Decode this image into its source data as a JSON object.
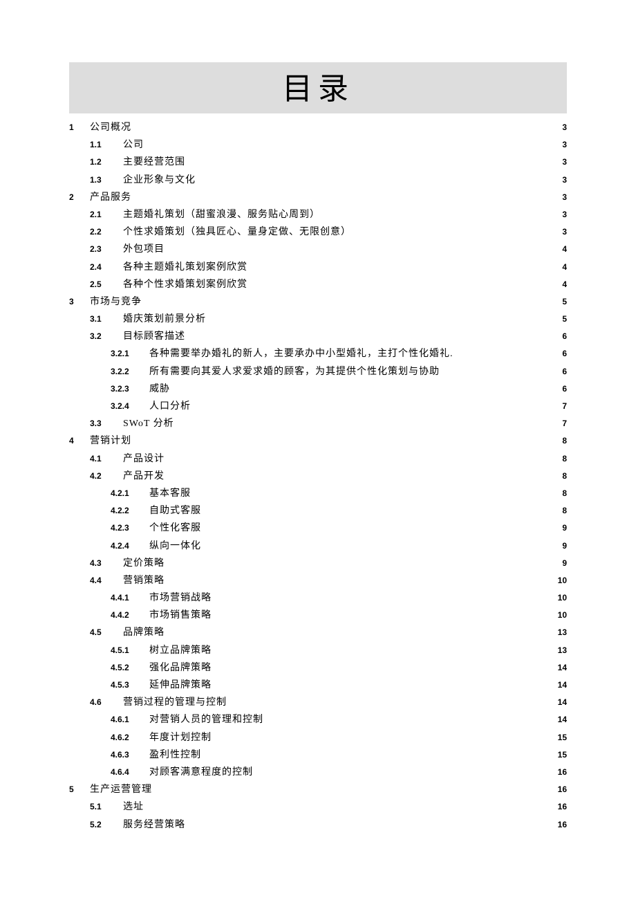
{
  "title": "目录",
  "toc": [
    {
      "level": 1,
      "num": "1",
      "label": "公司概况",
      "page": "3"
    },
    {
      "level": 2,
      "num": "1.1",
      "label": "公司",
      "page": "3"
    },
    {
      "level": 2,
      "num": "1.2",
      "label": "主要经营范围",
      "page": "3"
    },
    {
      "level": 2,
      "num": "1.3",
      "label": "企业形象与文化",
      "page": "3"
    },
    {
      "level": 1,
      "num": "2",
      "label": "产品服务",
      "page": "3"
    },
    {
      "level": 2,
      "num": "2.1",
      "label": "主题婚礼策划（甜蜜浪漫、服务贴心周到）",
      "page": "3"
    },
    {
      "level": 2,
      "num": "2.2",
      "label": "个性求婚策划（独具匠心、量身定做、无限创意）",
      "page": "3"
    },
    {
      "level": 2,
      "num": "2.3",
      "label": "外包项目",
      "page": "4"
    },
    {
      "level": 2,
      "num": "2.4",
      "label": "各种主题婚礼策划案例欣赏",
      "page": "4"
    },
    {
      "level": 2,
      "num": "2.5",
      "label": "各种个性求婚策划案例欣赏",
      "page": "4"
    },
    {
      "level": 1,
      "num": "3",
      "label": "市场与竞争",
      "page": "5"
    },
    {
      "level": 2,
      "num": "3.1",
      "label": "婚庆策划前景分析",
      "page": "5"
    },
    {
      "level": 2,
      "num": "3.2",
      "label": "目标顾客描述",
      "page": "6"
    },
    {
      "level": 3,
      "num": "3.2.1",
      "label": "各种需要举办婚礼的新人，主要承办中小型婚礼，主打个性化婚礼.",
      "page": "6",
      "sep": "short"
    },
    {
      "level": 3,
      "num": "3.2.2",
      "label": "所有需要向其爱人求爱求婚的顾客，为其提供个性化策划与协助",
      "page": "6"
    },
    {
      "level": 3,
      "num": "3.2.3",
      "label": "威胁",
      "page": "6"
    },
    {
      "level": 3,
      "num": "3.2.4",
      "label": "人口分析",
      "page": "7"
    },
    {
      "level": 2,
      "num": "3.3",
      "label": "SWoT 分析",
      "page": "7"
    },
    {
      "level": 1,
      "num": "4",
      "label": "营销计划",
      "page": "8"
    },
    {
      "level": 2,
      "num": "4.1",
      "label": "产品设计",
      "page": "8"
    },
    {
      "level": 2,
      "num": "4.2",
      "label": "产品开发",
      "page": "8"
    },
    {
      "level": 3,
      "num": "4.2.1",
      "label": "基本客服",
      "page": "8"
    },
    {
      "level": 3,
      "num": "4.2.2",
      "label": "自助式客服",
      "page": "8"
    },
    {
      "level": 3,
      "num": "4.2.3",
      "label": "个性化客服",
      "page": "9"
    },
    {
      "level": 3,
      "num": "4.2.4",
      "label": "纵向一体化",
      "page": "9"
    },
    {
      "level": 2,
      "num": "4.3",
      "label": "定价策略",
      "page": "9"
    },
    {
      "level": 2,
      "num": "4.4",
      "label": "营销策略",
      "page": "10"
    },
    {
      "level": 3,
      "num": "4.4.1",
      "label": "市场营销战略",
      "page": "10"
    },
    {
      "level": 3,
      "num": "4.4.2",
      "label": "市场销售策略",
      "page": "10"
    },
    {
      "level": 2,
      "num": "4.5",
      "label": "品牌策略",
      "page": "13"
    },
    {
      "level": 3,
      "num": "4.5.1",
      "label": "树立品牌策略",
      "page": "13"
    },
    {
      "level": 3,
      "num": "4.5.2",
      "label": "强化品牌策略",
      "page": "14"
    },
    {
      "level": 3,
      "num": "4.5.3",
      "label": "延伸品牌策略",
      "page": "14"
    },
    {
      "level": 2,
      "num": "4.6",
      "label": "营销过程的管理与控制",
      "page": "14"
    },
    {
      "level": 3,
      "num": "4.6.1",
      "label": "对营销人员的管理和控制",
      "page": "14"
    },
    {
      "level": 3,
      "num": "4.6.2",
      "label": "年度计划控制",
      "page": "15"
    },
    {
      "level": 3,
      "num": "4.6.3",
      "label": "盈利性控制",
      "page": "15"
    },
    {
      "level": 3,
      "num": "4.6.4",
      "label": "对顾客满意程度的控制",
      "page": "16"
    },
    {
      "level": 1,
      "num": "5",
      "label": "生产运营管理",
      "page": "16"
    },
    {
      "level": 2,
      "num": "5.1",
      "label": "选址",
      "page": "16"
    },
    {
      "level": 2,
      "num": "5.2",
      "label": "服务经营策略",
      "page": "16"
    }
  ]
}
